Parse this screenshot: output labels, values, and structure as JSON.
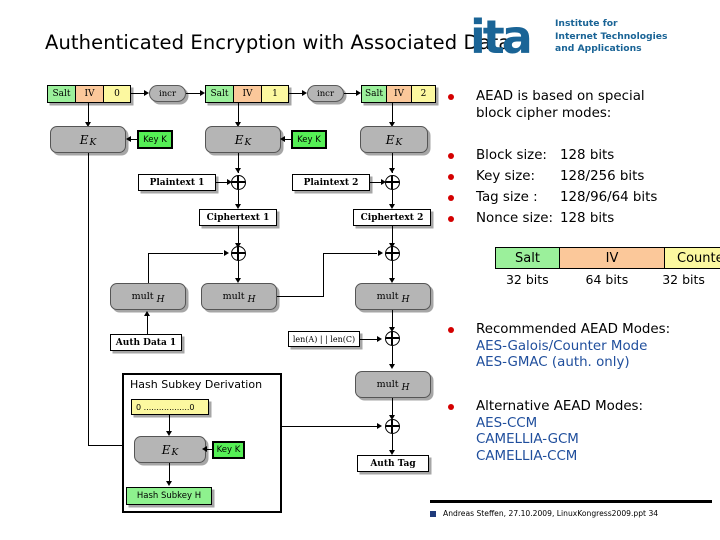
{
  "slide": {
    "title": "Authenticated Encryption with Associated Data",
    "logo": {
      "mark": "ita",
      "tagline_line1": "Institute for",
      "tagline_line2": "Internet Technologies",
      "tagline_line3": "and Applications"
    }
  },
  "diagram": {
    "counter_blocks": [
      {
        "salt": "Salt",
        "iv": "IV",
        "counter": "0"
      },
      {
        "salt": "Salt",
        "iv": "IV",
        "counter": "1"
      },
      {
        "salt": "Salt",
        "iv": "IV",
        "counter": "2"
      }
    ],
    "incr_labels": [
      "incr",
      "incr"
    ],
    "cipher_label_e": "E",
    "cipher_label_k": "K",
    "key_label": "Key K",
    "mult_label": "mult",
    "mult_sub": "H",
    "plaintexts": [
      "Plaintext 1",
      "Plaintext 2"
    ],
    "ciphertexts": [
      "Ciphertext 1",
      "Ciphertext 2"
    ],
    "auth_data": "Auth Data 1",
    "len_box": "len(A)  | | len(C)",
    "auth_tag": "Auth Tag",
    "hash_subkey": {
      "title": "Hash Subkey Derivation",
      "zero_block": "0 ..................0",
      "key_label": "Key K",
      "cipher_label_e": "E",
      "cipher_label_k": "K",
      "output": "Hash Subkey H"
    }
  },
  "bullets": {
    "intro_line1": "AEAD is based on special",
    "intro_line2": "block cipher modes:",
    "specs": [
      {
        "label": "Block size:",
        "value": "128 bits"
      },
      {
        "label": "Key size:",
        "value": "128/256 bits"
      },
      {
        "label": "Tag size :",
        "value": "128/96/64 bits"
      },
      {
        "label": "Nonce size:",
        "value": "128 bits"
      }
    ],
    "sic_table": {
      "cells": [
        "Salt",
        "IV",
        "Counter"
      ],
      "bits": [
        "32 bits",
        "64 bits",
        "32 bits"
      ]
    },
    "recommended": {
      "heading": "Recommended AEAD Modes:",
      "items": [
        "AES-Galois/Counter Mode",
        "AES-GMAC (auth. only)"
      ]
    },
    "alternative": {
      "heading": "Alternative AEAD Modes:",
      "items": [
        "AES-CCM",
        "CAMELLIA-GCM",
        "CAMELLIA-CCM"
      ]
    }
  },
  "footer": {
    "text": "Andreas Steffen, 27.10.2009, LinuxKongress2009.ppt 34"
  },
  "colors": {
    "salt": "#9bf09b",
    "iv": "#fbc89a",
    "counter": "#fcf8a0",
    "key": "#55ef55",
    "gray": "#b5b5b5",
    "bullet": "#d40000",
    "link": "#1f4e9c",
    "logo": "#1a6496"
  }
}
